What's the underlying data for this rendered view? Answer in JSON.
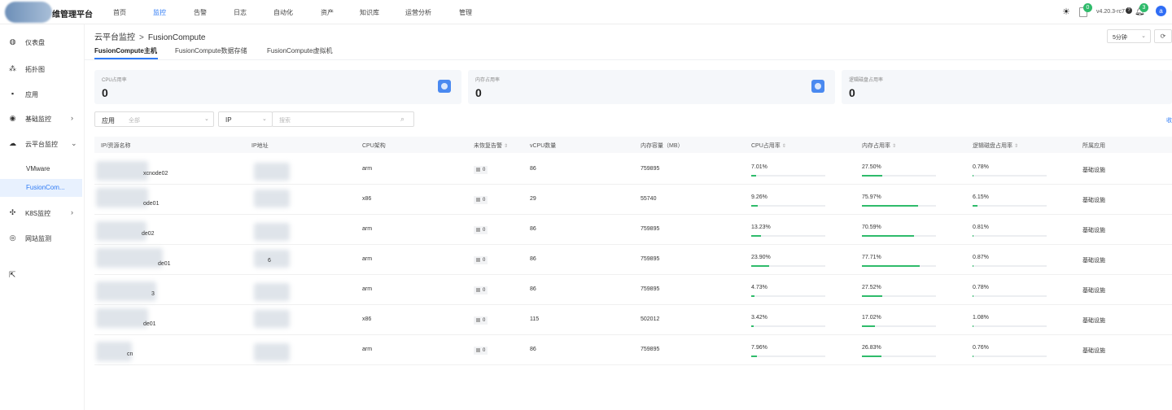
{
  "app": {
    "brand": "维管理平台"
  },
  "nav": [
    {
      "label": "首页",
      "active": false
    },
    {
      "label": "监控",
      "active": true
    },
    {
      "label": "告警",
      "active": false
    },
    {
      "label": "日志",
      "active": false
    },
    {
      "label": "自动化",
      "active": false
    },
    {
      "label": "资产",
      "active": false
    },
    {
      "label": "知识库",
      "active": false
    },
    {
      "label": "运营分析",
      "active": false
    },
    {
      "label": "管理",
      "active": false
    }
  ],
  "topright": {
    "doc_badge": "0",
    "version": "v4.20.3-rc7",
    "help": "?",
    "bell_badge": "3",
    "avatar": "a"
  },
  "sidebar": {
    "items": [
      {
        "label": "仪表盘",
        "icon": "dashboard-icon",
        "glyph": "◍"
      },
      {
        "label": "拓扑图",
        "icon": "topology-icon",
        "glyph": "⁂"
      },
      {
        "label": "应用",
        "icon": "apps-icon",
        "glyph": "▪"
      },
      {
        "label": "基础监控",
        "icon": "camera-icon",
        "glyph": "◉",
        "chevron": "›"
      },
      {
        "label": "云平台监控",
        "icon": "cloud-icon",
        "glyph": "☁",
        "chevron": "⌄"
      },
      {
        "label": "VMware",
        "sub": true
      },
      {
        "label": "FusionCom...",
        "sub": true,
        "active": true
      },
      {
        "label": "K8S监控",
        "icon": "k8s-icon",
        "glyph": "✣",
        "chevron": "›"
      },
      {
        "label": "网站监测",
        "icon": "globe-icon",
        "glyph": "◎"
      }
    ]
  },
  "breadcrumb": {
    "parent": "云平台监控",
    "sep": ">",
    "current": "FusionCompute"
  },
  "interval": {
    "value": "5分钟",
    "refresh_glyph": "⟳"
  },
  "tabs": [
    {
      "label": "FusionCompute主机",
      "active": true
    },
    {
      "label": "FusionCompute数据存储",
      "active": false
    },
    {
      "label": "FusionCompute虚拟机",
      "active": false
    }
  ],
  "cards": [
    {
      "title": "CPU占用率",
      "value": "0"
    },
    {
      "title": "内存占用率",
      "value": "0"
    },
    {
      "title": "逻辑磁盘占用率",
      "value": "0"
    }
  ],
  "filters": {
    "app_label": "应用",
    "app_placeholder": "全部",
    "ip_label": "IP",
    "search_placeholder": "搜索",
    "export": "收"
  },
  "table": {
    "columns": [
      "IP/资源名称",
      "IP地址",
      "CPU架构",
      "未恢复告警",
      "vCPU数量",
      "内存容量（MB）",
      "CPU占用率",
      "内存占用率",
      "逻辑磁盘占用率",
      "所属应用"
    ],
    "rows": [
      {
        "name": "xcnode02",
        "ip": "",
        "arch": "arm",
        "alerts": "0",
        "vcpu": "86",
        "mem": "759895",
        "cpu": "7.01%",
        "cpu_v": 7.01,
        "memp": "27.50%",
        "memp_v": 27.5,
        "disk": "0.78%",
        "disk_v": 0.78,
        "app": "基础设施"
      },
      {
        "name": "ode01",
        "ip": "",
        "arch": "x86",
        "alerts": "0",
        "vcpu": "29",
        "mem": "55740",
        "cpu": "9.26%",
        "cpu_v": 9.26,
        "memp": "75.97%",
        "memp_v": 75.97,
        "disk": "6.15%",
        "disk_v": 6.15,
        "app": "基础设施"
      },
      {
        "name": "de02",
        "ip": "",
        "arch": "arm",
        "alerts": "0",
        "vcpu": "86",
        "mem": "759895",
        "cpu": "13.23%",
        "cpu_v": 13.23,
        "memp": "70.59%",
        "memp_v": 70.59,
        "disk": "0.81%",
        "disk_v": 0.81,
        "app": "基础设施"
      },
      {
        "name": "de01",
        "ip": "6",
        "arch": "arm",
        "alerts": "0",
        "vcpu": "86",
        "mem": "759895",
        "cpu": "23.90%",
        "cpu_v": 23.9,
        "memp": "77.71%",
        "memp_v": 77.71,
        "disk": "0.87%",
        "disk_v": 0.87,
        "app": "基础设施"
      },
      {
        "name": "3",
        "ip": "",
        "arch": "arm",
        "alerts": "0",
        "vcpu": "86",
        "mem": "759895",
        "cpu": "4.73%",
        "cpu_v": 4.73,
        "memp": "27.52%",
        "memp_v": 27.52,
        "disk": "0.78%",
        "disk_v": 0.78,
        "app": "基础设施"
      },
      {
        "name": "de01",
        "ip": "",
        "arch": "x86",
        "alerts": "0",
        "vcpu": "115",
        "mem": "502012",
        "cpu": "3.42%",
        "cpu_v": 3.42,
        "memp": "17.02%",
        "memp_v": 17.02,
        "disk": "1.08%",
        "disk_v": 1.08,
        "app": "基础设施"
      },
      {
        "name": "cn",
        "ip": "",
        "arch": "arm",
        "alerts": "0",
        "vcpu": "86",
        "mem": "759895",
        "cpu": "7.96%",
        "cpu_v": 7.96,
        "memp": "26.83%",
        "memp_v": 26.83,
        "disk": "0.76%",
        "disk_v": 0.76,
        "app": "基础设施"
      }
    ]
  },
  "colors": {
    "accent": "#2f7bf5",
    "bar": "#2fbb6b"
  }
}
